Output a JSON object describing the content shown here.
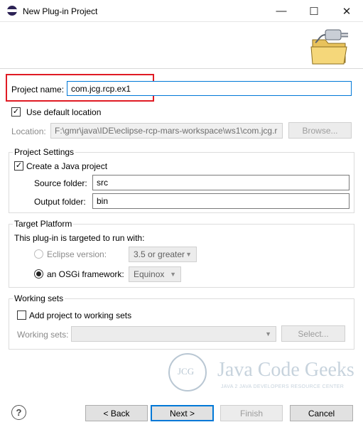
{
  "window": {
    "title": "New Plug-in Project",
    "minimize": "—",
    "maximize": "☐",
    "close": "✕"
  },
  "project": {
    "name_label": "Project name:",
    "name_value": "com.jcg.rcp.ex1",
    "use_default_location_label": "Use default location",
    "location_label": "Location:",
    "location_value": "F:\\gmr\\java\\IDE\\eclipse-rcp-mars-workspace\\ws1\\com.jcg.r",
    "browse_label": "Browse..."
  },
  "project_settings": {
    "title": "Project Settings",
    "create_java_label": "Create a Java project",
    "source_folder_label": "Source folder:",
    "source_folder_value": "src",
    "output_folder_label": "Output folder:",
    "output_folder_value": "bin"
  },
  "target_platform": {
    "title": "Target Platform",
    "intro": "This plug-in is targeted to run with:",
    "eclipse_version_label": "Eclipse version:",
    "eclipse_version_value": "3.5 or greater",
    "osgi_label": "an OSGi framework:",
    "osgi_value": "Equinox"
  },
  "working_sets": {
    "title": "Working sets",
    "add_label": "Add project to working sets",
    "sets_label": "Working sets:",
    "select_label": "Select..."
  },
  "watermark": {
    "logo_text": "JCG",
    "brand": "Java Code Geeks",
    "tagline": "JAVA 2 JAVA DEVELOPERS RESOURCE CENTER"
  },
  "footer": {
    "help": "?",
    "back_label": "< Back",
    "next_label": "Next >",
    "finish_label": "Finish",
    "cancel_label": "Cancel"
  }
}
